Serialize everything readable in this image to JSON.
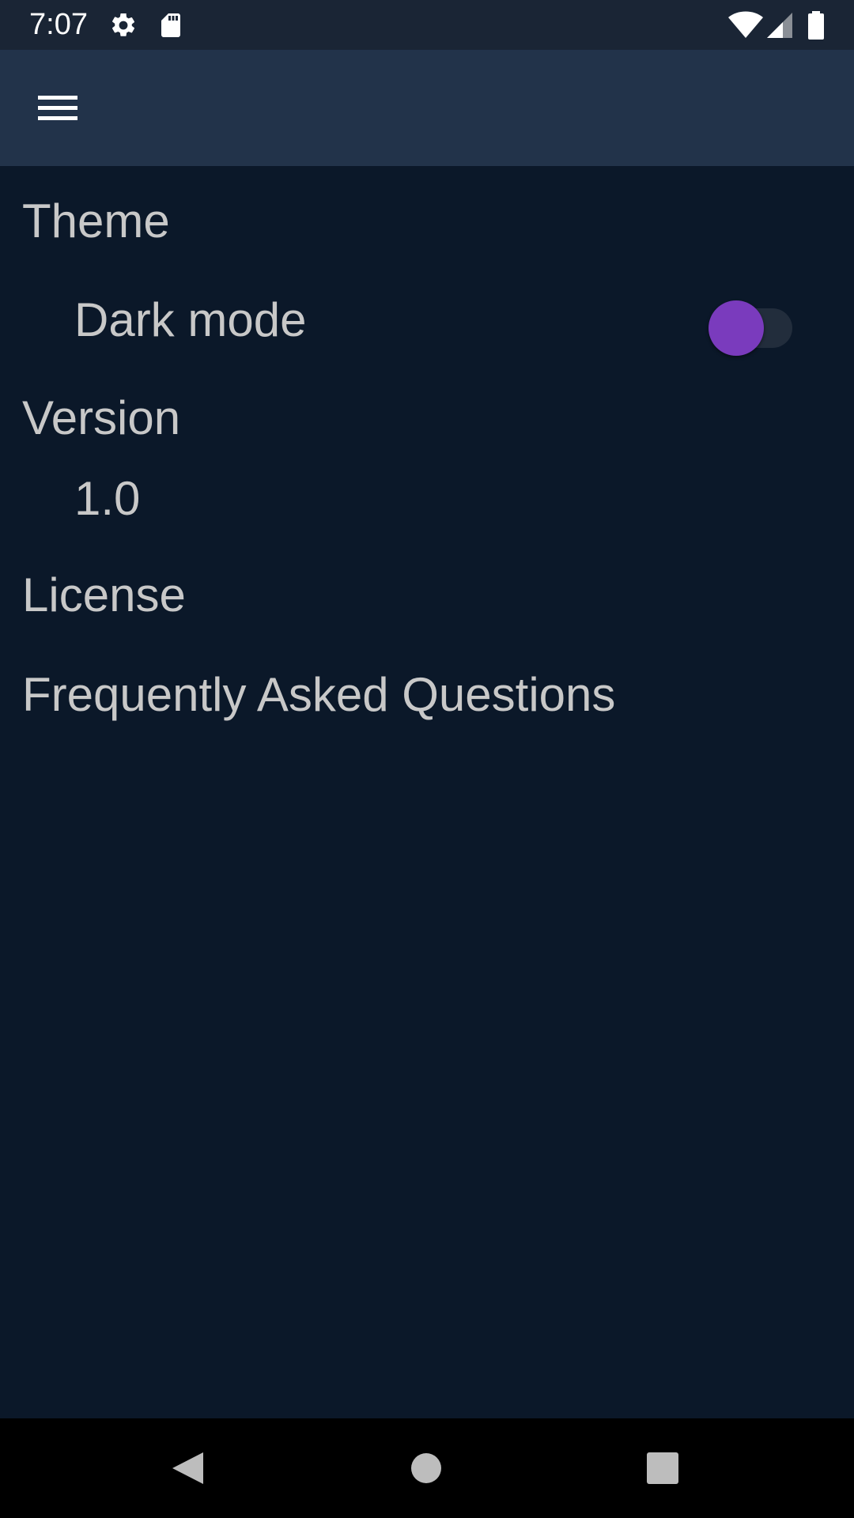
{
  "status_bar": {
    "time": "7:07",
    "icons": [
      "gear-icon",
      "sd-card-icon",
      "wifi-icon",
      "cell-signal-icon",
      "battery-icon"
    ]
  },
  "app_bar": {
    "menu_icon": "hamburger-menu-icon"
  },
  "settings": {
    "theme_header": "Theme",
    "dark_mode_label": "Dark mode",
    "dark_mode_enabled": false,
    "version_header": "Version",
    "version_value": "1.0",
    "license_label": "License",
    "faq_label": "Frequently Asked Questions"
  },
  "nav_bar": {
    "icons": [
      "back-icon",
      "home-icon",
      "recents-icon"
    ]
  },
  "colors": {
    "background": "#0b1829",
    "app_bar": "#22334a",
    "status_bar": "#1a2535",
    "text": "#c8c8c8",
    "toggle_thumb": "#7a3bbd",
    "toggle_track": "#222d3c"
  }
}
